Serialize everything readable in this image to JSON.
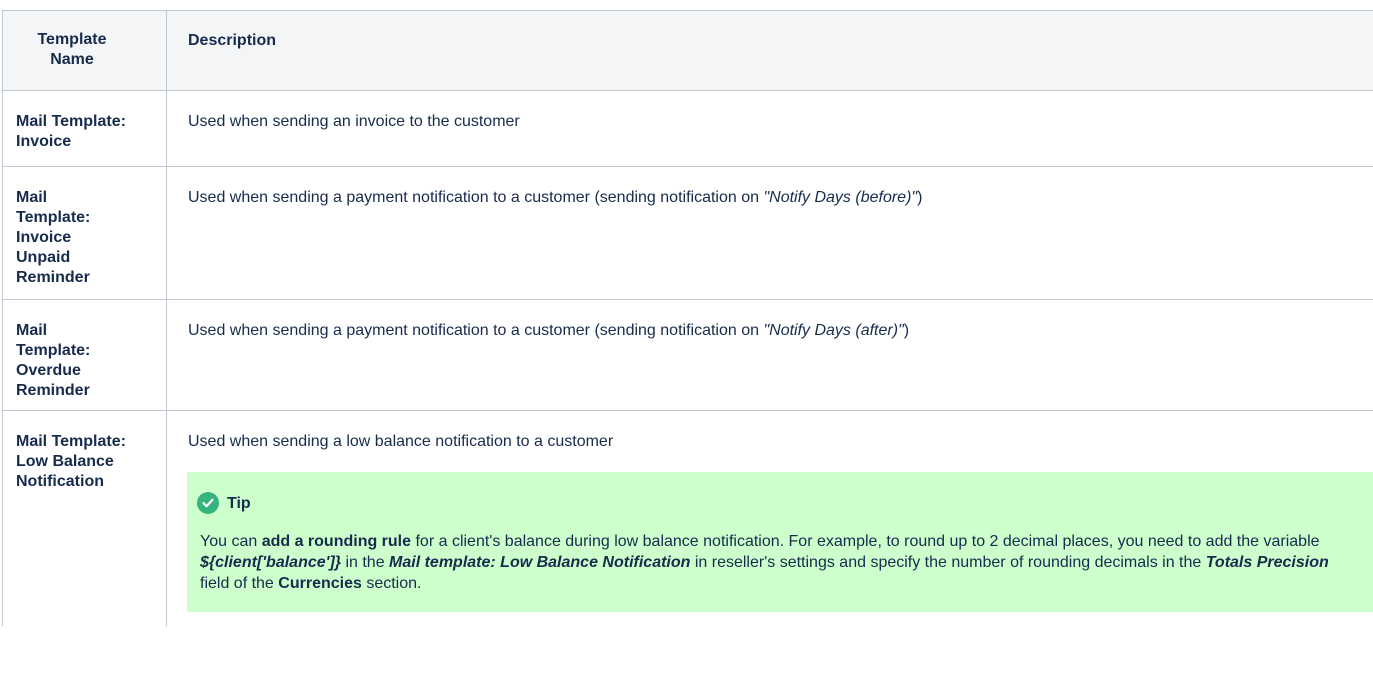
{
  "table": {
    "headers": {
      "name": "Template Name",
      "description": "Description"
    },
    "rows": [
      {
        "name": "Mail Template: Invoice",
        "description": "Used when sending an invoice to the customer"
      },
      {
        "name": "Mail Template: Invoice Unpaid Reminder",
        "description_prefix": "Used when sending a payment notification to a customer (sending notification on ",
        "description_em": "\"Notify Days (before)\"",
        "description_suffix": ")"
      },
      {
        "name": "Mail Template: Overdue Reminder",
        "description_prefix": "Used when sending a payment notification to a customer (sending notification on ",
        "description_em": "\"Notify Days (after)\"",
        "description_suffix": ")"
      },
      {
        "name": "Mail Template: Low Balance Notification",
        "description": "Used when sending a low balance notification to a customer",
        "tip": {
          "icon": "check-circle-icon",
          "title": "Tip",
          "t1": "You can ",
          "b1": "add a rounding rule",
          "t2": " for a client's balance during low balance notification.  For example, to round up to 2 decimal places, you need to add the variable ",
          "bi1": "${client['balance']}",
          "t3": " in the ",
          "bi2": "Mail template: Low Balance Notification",
          "t4": " in reseller's settings and specify the number of rounding decimals in the ",
          "bi3": "Totals Precision",
          "t5": " field of the ",
          "b2": "Currencies",
          "t6": " section."
        }
      }
    ]
  },
  "colors": {
    "header_bg": "#f4f5f7",
    "border": "#c1c7d0",
    "tip_bg": "#ccffcc",
    "tip_icon": "#36b37e",
    "text": "#172b4d"
  }
}
